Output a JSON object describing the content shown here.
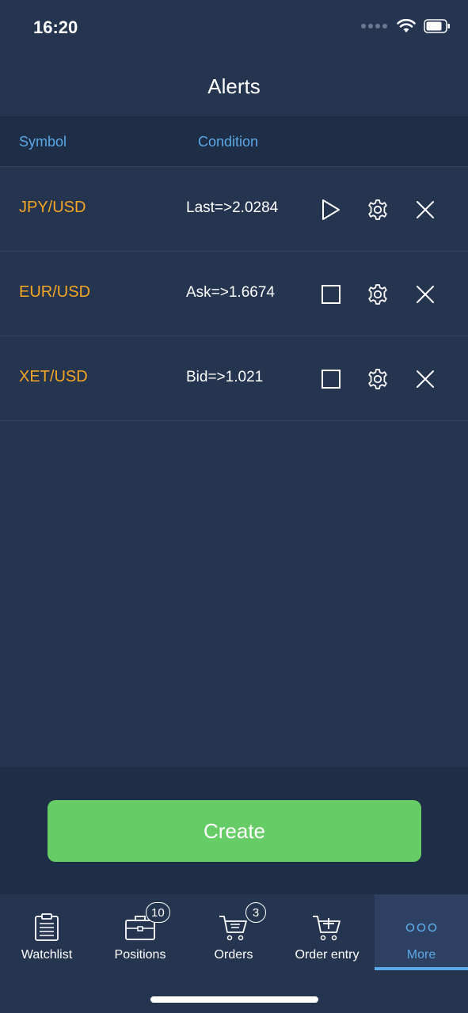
{
  "status_bar": {
    "time": "16:20"
  },
  "header": {
    "title": "Alerts"
  },
  "table": {
    "col_symbol": "Symbol",
    "col_condition": "Condition"
  },
  "alerts": [
    {
      "symbol": "JPY/USD",
      "condition": "Last=>2.0284",
      "state": "paused",
      "toggle_icon": "play-icon"
    },
    {
      "symbol": "EUR/USD",
      "condition": "Ask=>1.6674",
      "state": "active",
      "toggle_icon": "stop-icon"
    },
    {
      "symbol": "XET/USD",
      "condition": "Bid=>1.021",
      "state": "active",
      "toggle_icon": "stop-icon"
    }
  ],
  "create_label": "Create",
  "tabs": [
    {
      "label": "Watchlist",
      "icon": "clipboard-icon"
    },
    {
      "label": "Positions",
      "icon": "briefcase-icon",
      "badge": "10"
    },
    {
      "label": "Orders",
      "icon": "cart-icon",
      "badge": "3"
    },
    {
      "label": "Order entry",
      "icon": "cart-plus-icon"
    },
    {
      "label": "More",
      "icon": "more-icon",
      "active": true
    }
  ],
  "colors": {
    "background": "#25344f",
    "symbol": "#f5a623",
    "header_text": "#5aa8e6",
    "create_button": "#66cc66",
    "active_tab": "#5aa8e6"
  }
}
